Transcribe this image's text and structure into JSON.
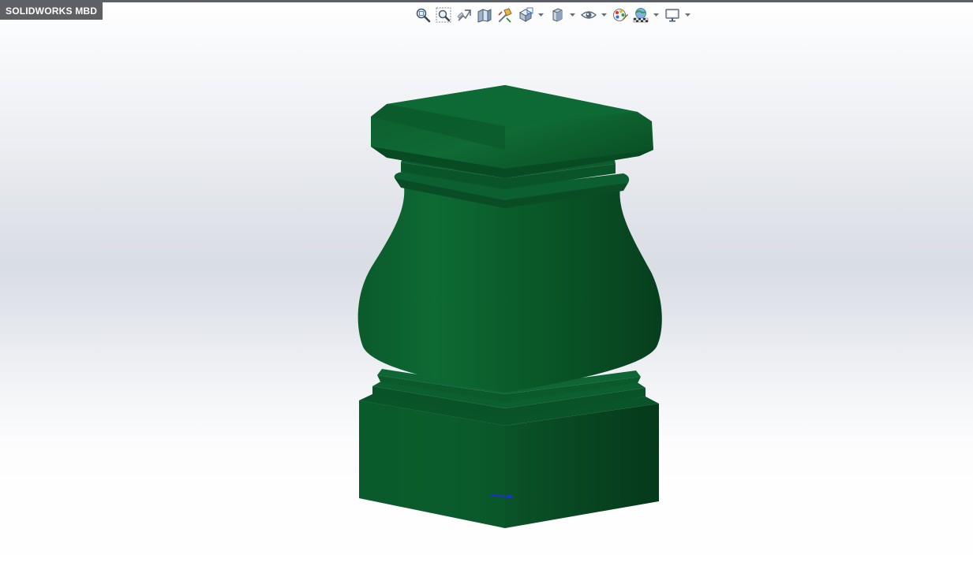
{
  "app": {
    "badge_label": "SOLIDWORKS MBD"
  },
  "toolbar": {
    "buttons": [
      {
        "icon": "zoom-to-fit-icon",
        "has_dropdown": false
      },
      {
        "icon": "zoom-to-area-icon",
        "has_dropdown": false
      },
      {
        "icon": "previous-view-icon",
        "has_dropdown": false
      },
      {
        "icon": "section-view-icon",
        "has_dropdown": false
      },
      {
        "icon": "dynamic-annotation-views-icon",
        "has_dropdown": false
      },
      {
        "icon": "view-orientation-icon",
        "has_dropdown": true
      },
      {
        "icon": "display-style-icon",
        "has_dropdown": true
      },
      {
        "icon": "hide-show-items-icon",
        "has_dropdown": true
      },
      {
        "icon": "edit-appearance-icon",
        "has_dropdown": false
      },
      {
        "icon": "apply-scene-icon",
        "has_dropdown": true
      },
      {
        "icon": "view-settings-monitor-icon",
        "has_dropdown": true
      }
    ]
  },
  "model": {
    "description_color": "#0b5a2c",
    "highlight_color": "#0d7a38",
    "shadow_color": "#063d1d",
    "origin_marker_color": "#1f2fd6"
  },
  "colors": {
    "badge_bg": "#5e6064",
    "badge_text": "#ffffff",
    "viewport_top": "#ffffff",
    "viewport_mid": "#d9dde4"
  }
}
